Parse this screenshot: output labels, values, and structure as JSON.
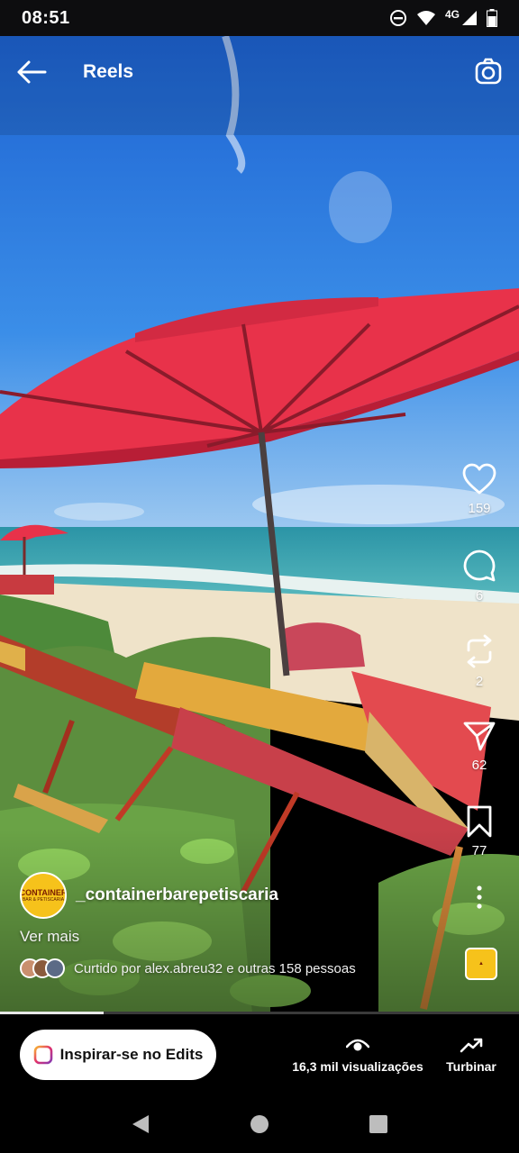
{
  "status_bar": {
    "time": "08:51",
    "network": "4G",
    "icons": [
      "do-not-disturb-icon",
      "wifi-icon",
      "signal-icon",
      "battery-icon"
    ]
  },
  "header": {
    "title": "Reels",
    "back_icon": "arrow-left-icon",
    "camera_icon": "camera-icon"
  },
  "actions": {
    "likes": "159",
    "comments": "6",
    "reposts": "2",
    "shares": "62",
    "saves": "77"
  },
  "post": {
    "username": "_containerbarepetiscaria",
    "avatar_text": "CONTAINER",
    "avatar_subtext": "BAR & PETISCARIA",
    "more_label": "Ver mais",
    "liked_by": "Curtido por alex.abreu32 e outras 158 pessoas",
    "progress": 0.2
  },
  "bottom": {
    "edits_button": "Inspirar-se no Edits",
    "views": "16,3 mil visualizações",
    "boost": "Turbinar"
  },
  "colors": {
    "umbrella": "#e8324a",
    "sky": "#1b6fd8",
    "sea": "#2aa0a8",
    "sand": "#efe3c9",
    "badge": "#f6c21b"
  }
}
